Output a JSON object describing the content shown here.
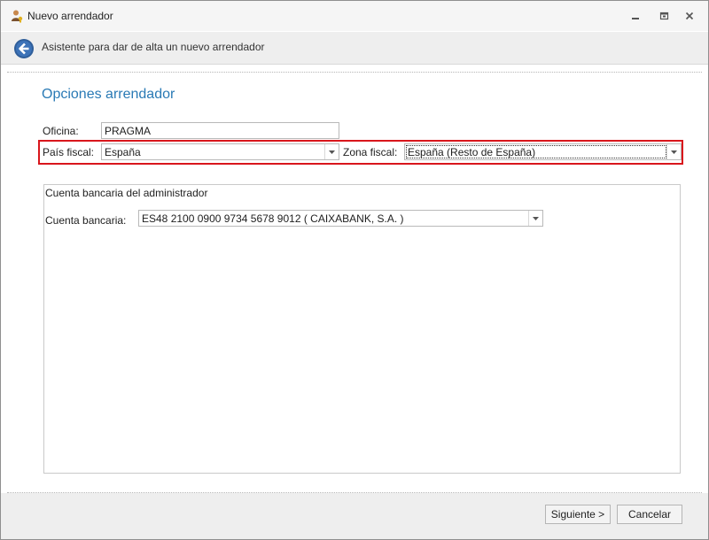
{
  "window": {
    "title": "Nuevo arrendador",
    "icon": "user-key-icon",
    "controls": [
      "minimize-icon",
      "restore-icon",
      "close-icon"
    ]
  },
  "wizard": {
    "header_text": "Asistente para dar de alta un nuevo arrendador",
    "back_icon": "back-arrow-icon",
    "page_title": "Opciones arrendador"
  },
  "form": {
    "oficina_label": "Oficina:",
    "oficina_value": "PRAGMA",
    "pais_label": "País fiscal:",
    "pais_value": "España",
    "zona_label": "Zona fiscal:",
    "zona_value": "España (Resto de España)"
  },
  "bank_group": {
    "title": "Cuenta bancaria del administrador",
    "cuenta_label": "Cuenta bancaria:",
    "cuenta_value": "ES48 2100 0900 9734 5678 9012 ( CAIXABANK, S.A. )"
  },
  "footer": {
    "next_label": "Siguiente >",
    "cancel_label": "Cancelar"
  },
  "colors": {
    "accent": "#2a7ab5",
    "highlight_border": "#d9161c",
    "header_bg": "#eeeeee"
  }
}
